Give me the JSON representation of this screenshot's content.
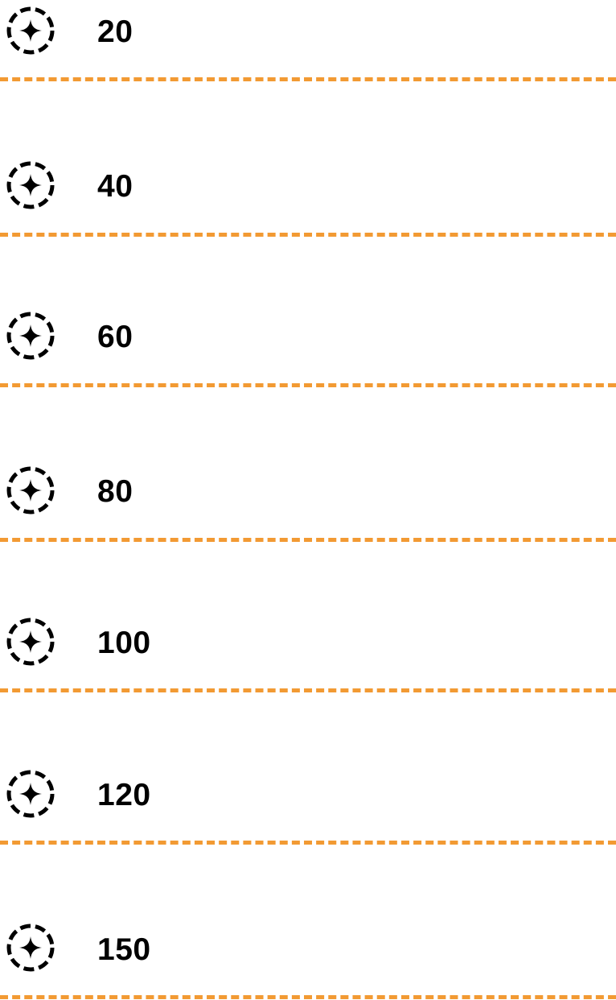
{
  "options": [
    {
      "label": "20",
      "icon": "sparkle-dashed-circle-icon"
    },
    {
      "label": "40",
      "icon": "sparkle-dashed-circle-icon"
    },
    {
      "label": "60",
      "icon": "sparkle-dashed-circle-icon"
    },
    {
      "label": "80",
      "icon": "sparkle-dashed-circle-icon"
    },
    {
      "label": "100",
      "icon": "sparkle-dashed-circle-icon"
    },
    {
      "label": "120",
      "icon": "sparkle-dashed-circle-icon"
    },
    {
      "label": "150",
      "icon": "sparkle-dashed-circle-icon"
    }
  ],
  "colors": {
    "divider": "#F29A33",
    "text": "#000000",
    "icon": "#000000",
    "background": "#FFFFFF"
  }
}
